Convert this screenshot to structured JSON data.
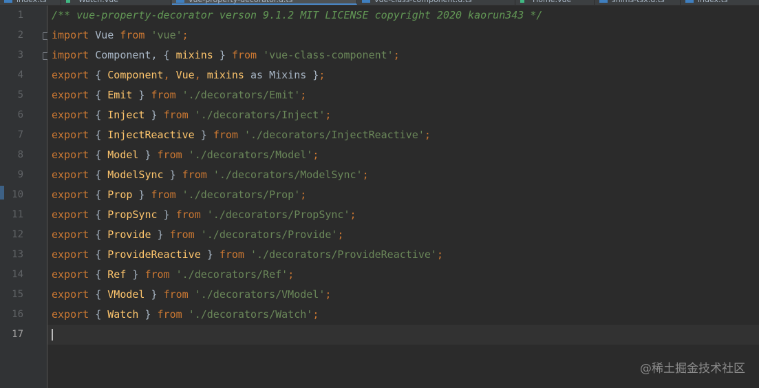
{
  "tabs": [
    {
      "label": "index.ts",
      "icon": "typescript-file-icon",
      "active": false
    },
    {
      "label": "Watch.vue",
      "icon": "vue-file-icon",
      "active": false
    },
    {
      "label": "vue-property-decorator.d.ts",
      "icon": "typescript-file-icon",
      "active": true
    },
    {
      "label": "vue-class-component.d.ts",
      "icon": "typescript-file-icon",
      "active": false
    },
    {
      "label": "Home.vue",
      "icon": "vue-file-icon",
      "active": false
    },
    {
      "label": "shims-tsx.d.ts",
      "icon": "typescript-file-icon",
      "active": false
    },
    {
      "label": "index.ts",
      "icon": "typescript-file-icon",
      "active": false
    }
  ],
  "editor": {
    "current_line": 17,
    "lines": [
      {
        "n": "1",
        "tokens": [
          {
            "t": "/** vue-property-decorator verson 9.1.2 MIT LICENSE copyright 2020 kaorun343 */",
            "c": "cmt"
          }
        ]
      },
      {
        "n": "2",
        "fold": true,
        "tokens": [
          {
            "t": "import",
            "c": "kw"
          },
          {
            "t": " Vue ",
            "c": "ident"
          },
          {
            "t": "from",
            "c": "kw"
          },
          {
            "t": " ",
            "c": "ident"
          },
          {
            "t": "'vue'",
            "c": "str"
          },
          {
            "t": ";",
            "c": "kw"
          }
        ]
      },
      {
        "n": "3",
        "fold": true,
        "tokens": [
          {
            "t": "import",
            "c": "kw"
          },
          {
            "t": " Component, { ",
            "c": "ident"
          },
          {
            "t": "mixins",
            "c": "export-name"
          },
          {
            "t": " } ",
            "c": "ident"
          },
          {
            "t": "from",
            "c": "kw"
          },
          {
            "t": " ",
            "c": "ident"
          },
          {
            "t": "'vue-class-component'",
            "c": "str"
          },
          {
            "t": ";",
            "c": "kw"
          }
        ]
      },
      {
        "n": "4",
        "tokens": [
          {
            "t": "export",
            "c": "kw"
          },
          {
            "t": " { ",
            "c": "ident"
          },
          {
            "t": "Component",
            "c": "export-name"
          },
          {
            "t": ", ",
            "c": "kw"
          },
          {
            "t": "Vue",
            "c": "export-name"
          },
          {
            "t": ", ",
            "c": "kw"
          },
          {
            "t": "mixins",
            "c": "export-name"
          },
          {
            "t": " as ",
            "c": "ident"
          },
          {
            "t": "Mixins",
            "c": "ident"
          },
          {
            "t": " }",
            "c": "ident"
          },
          {
            "t": ";",
            "c": "kw"
          }
        ]
      },
      {
        "n": "5",
        "tokens": [
          {
            "t": "export",
            "c": "kw"
          },
          {
            "t": " { ",
            "c": "ident"
          },
          {
            "t": "Emit",
            "c": "export-name"
          },
          {
            "t": " } ",
            "c": "ident"
          },
          {
            "t": "from",
            "c": "kw"
          },
          {
            "t": " ",
            "c": "ident"
          },
          {
            "t": "'./decorators/Emit'",
            "c": "str"
          },
          {
            "t": ";",
            "c": "kw"
          }
        ]
      },
      {
        "n": "6",
        "tokens": [
          {
            "t": "export",
            "c": "kw"
          },
          {
            "t": " { ",
            "c": "ident"
          },
          {
            "t": "Inject",
            "c": "export-name"
          },
          {
            "t": " } ",
            "c": "ident"
          },
          {
            "t": "from",
            "c": "kw"
          },
          {
            "t": " ",
            "c": "ident"
          },
          {
            "t": "'./decorators/Inject'",
            "c": "str"
          },
          {
            "t": ";",
            "c": "kw"
          }
        ]
      },
      {
        "n": "7",
        "tokens": [
          {
            "t": "export",
            "c": "kw"
          },
          {
            "t": " { ",
            "c": "ident"
          },
          {
            "t": "InjectReactive",
            "c": "export-name"
          },
          {
            "t": " } ",
            "c": "ident"
          },
          {
            "t": "from",
            "c": "kw"
          },
          {
            "t": " ",
            "c": "ident"
          },
          {
            "t": "'./decorators/InjectReactive'",
            "c": "str"
          },
          {
            "t": ";",
            "c": "kw"
          }
        ]
      },
      {
        "n": "8",
        "tokens": [
          {
            "t": "export",
            "c": "kw"
          },
          {
            "t": " { ",
            "c": "ident"
          },
          {
            "t": "Model",
            "c": "export-name"
          },
          {
            "t": " } ",
            "c": "ident"
          },
          {
            "t": "from",
            "c": "kw"
          },
          {
            "t": " ",
            "c": "ident"
          },
          {
            "t": "'./decorators/Model'",
            "c": "str"
          },
          {
            "t": ";",
            "c": "kw"
          }
        ]
      },
      {
        "n": "9",
        "tokens": [
          {
            "t": "export",
            "c": "kw"
          },
          {
            "t": " { ",
            "c": "ident"
          },
          {
            "t": "ModelSync",
            "c": "export-name"
          },
          {
            "t": " } ",
            "c": "ident"
          },
          {
            "t": "from",
            "c": "kw"
          },
          {
            "t": " ",
            "c": "ident"
          },
          {
            "t": "'./decorators/ModelSync'",
            "c": "str"
          },
          {
            "t": ";",
            "c": "kw"
          }
        ]
      },
      {
        "n": "10",
        "tokens": [
          {
            "t": "export",
            "c": "kw"
          },
          {
            "t": " { ",
            "c": "ident"
          },
          {
            "t": "Prop",
            "c": "export-name"
          },
          {
            "t": " } ",
            "c": "ident"
          },
          {
            "t": "from",
            "c": "kw"
          },
          {
            "t": " ",
            "c": "ident"
          },
          {
            "t": "'./decorators/Prop'",
            "c": "str"
          },
          {
            "t": ";",
            "c": "kw"
          }
        ]
      },
      {
        "n": "11",
        "tokens": [
          {
            "t": "export",
            "c": "kw"
          },
          {
            "t": " { ",
            "c": "ident"
          },
          {
            "t": "PropSync",
            "c": "export-name"
          },
          {
            "t": " } ",
            "c": "ident"
          },
          {
            "t": "from",
            "c": "kw"
          },
          {
            "t": " ",
            "c": "ident"
          },
          {
            "t": "'./decorators/PropSync'",
            "c": "str"
          },
          {
            "t": ";",
            "c": "kw"
          }
        ]
      },
      {
        "n": "12",
        "tokens": [
          {
            "t": "export",
            "c": "kw"
          },
          {
            "t": " { ",
            "c": "ident"
          },
          {
            "t": "Provide",
            "c": "export-name"
          },
          {
            "t": " } ",
            "c": "ident"
          },
          {
            "t": "from",
            "c": "kw"
          },
          {
            "t": " ",
            "c": "ident"
          },
          {
            "t": "'./decorators/Provide'",
            "c": "str"
          },
          {
            "t": ";",
            "c": "kw"
          }
        ]
      },
      {
        "n": "13",
        "tokens": [
          {
            "t": "export",
            "c": "kw"
          },
          {
            "t": " { ",
            "c": "ident"
          },
          {
            "t": "ProvideReactive",
            "c": "export-name"
          },
          {
            "t": " } ",
            "c": "ident"
          },
          {
            "t": "from",
            "c": "kw"
          },
          {
            "t": " ",
            "c": "ident"
          },
          {
            "t": "'./decorators/ProvideReactive'",
            "c": "str"
          },
          {
            "t": ";",
            "c": "kw"
          }
        ]
      },
      {
        "n": "14",
        "tokens": [
          {
            "t": "export",
            "c": "kw"
          },
          {
            "t": " { ",
            "c": "ident"
          },
          {
            "t": "Ref",
            "c": "export-name"
          },
          {
            "t": " } ",
            "c": "ident"
          },
          {
            "t": "from",
            "c": "kw"
          },
          {
            "t": " ",
            "c": "ident"
          },
          {
            "t": "'./decorators/Ref'",
            "c": "str"
          },
          {
            "t": ";",
            "c": "kw"
          }
        ]
      },
      {
        "n": "15",
        "tokens": [
          {
            "t": "export",
            "c": "kw"
          },
          {
            "t": " { ",
            "c": "ident"
          },
          {
            "t": "VModel",
            "c": "export-name"
          },
          {
            "t": " } ",
            "c": "ident"
          },
          {
            "t": "from",
            "c": "kw"
          },
          {
            "t": " ",
            "c": "ident"
          },
          {
            "t": "'./decorators/VModel'",
            "c": "str"
          },
          {
            "t": ";",
            "c": "kw"
          }
        ]
      },
      {
        "n": "16",
        "tokens": [
          {
            "t": "export",
            "c": "kw"
          },
          {
            "t": " { ",
            "c": "ident"
          },
          {
            "t": "Watch",
            "c": "export-name"
          },
          {
            "t": " } ",
            "c": "ident"
          },
          {
            "t": "from",
            "c": "kw"
          },
          {
            "t": " ",
            "c": "ident"
          },
          {
            "t": "'./decorators/Watch'",
            "c": "str"
          },
          {
            "t": ";",
            "c": "kw"
          }
        ]
      },
      {
        "n": "17",
        "tokens": []
      }
    ]
  },
  "watermark": "@稀土掘金技术社区",
  "colors": {
    "background": "#2b2b2b",
    "gutter": "#313335",
    "keyword": "#cc7832",
    "string": "#6a8759",
    "comment": "#629755",
    "identifier": "#a9b7c6",
    "export_name": "#ffc66d",
    "line_number": "#606366"
  }
}
